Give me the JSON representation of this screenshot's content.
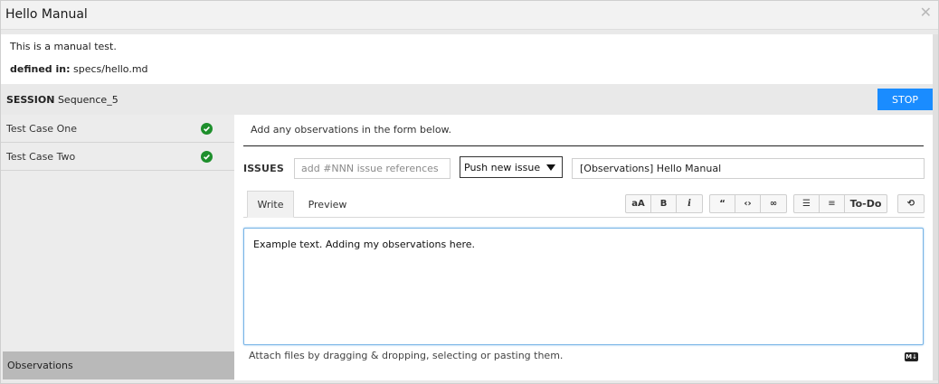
{
  "window": {
    "title": "Hello Manual",
    "close_icon": "close-icon"
  },
  "info": {
    "description": "This is a manual test.",
    "defined_label": "defined in:",
    "defined_value": "specs/hello.md"
  },
  "session": {
    "label": "SESSION",
    "name": "Sequence_5",
    "stop_label": "STOP",
    "accent": "#1a8cff"
  },
  "sidebar": {
    "cases": [
      {
        "label": "Test Case One",
        "status_icon": "check-circle-icon"
      },
      {
        "label": "Test Case Two",
        "status_icon": "check-circle-icon"
      }
    ],
    "observations_label": "Observations"
  },
  "main": {
    "hint": "Add any observations in the form below.",
    "issues_label": "ISSUES",
    "issue_placeholder": "add #NNN issue references",
    "push_select": "Push new issue",
    "issue_title": "[Observations] Hello Manual",
    "tabs": {
      "write": "Write",
      "preview": "Preview"
    },
    "toolbar": {
      "header": "aA",
      "bold": "B",
      "italic": "i",
      "quote": "“",
      "code": "‹›",
      "link": "∞",
      "ul": "☰",
      "ol": "≡",
      "todo": "To-Do",
      "undo": "⟲"
    },
    "editor_text": "Example text. Adding my observations here.",
    "attach_hint": "Attach files by dragging & dropping, selecting or pasting them.",
    "md_icon": "markdown-icon"
  }
}
